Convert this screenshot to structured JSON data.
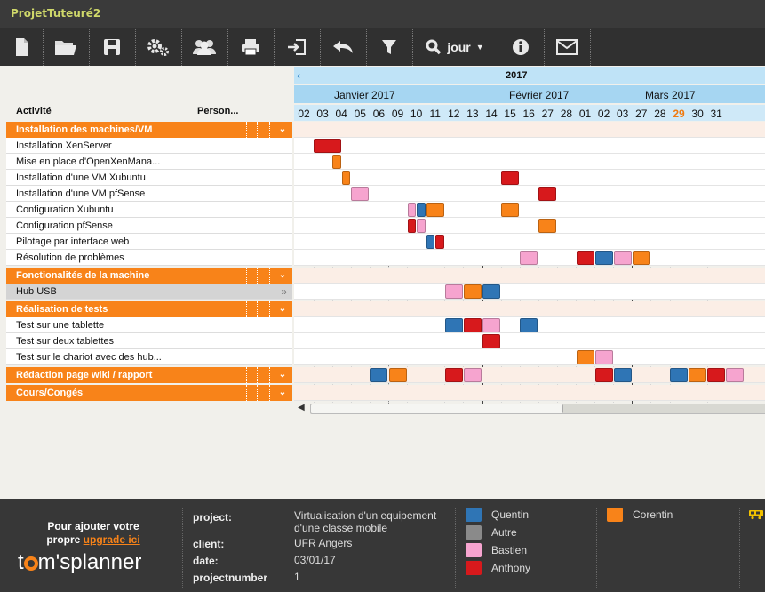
{
  "app": {
    "title": "ProjetTuteuré2"
  },
  "toolbar": {
    "view_label": "jour"
  },
  "columns": {
    "activity": "Activité",
    "person": "Person..."
  },
  "timeline": {
    "year": "2017",
    "months": [
      "Janvier 2017",
      "Février 2017",
      "Mars 2017"
    ],
    "days": [
      "02",
      "03",
      "04",
      "05",
      "06",
      "09",
      "10",
      "11",
      "12",
      "13",
      "14",
      "15",
      "16",
      "27",
      "28",
      "01",
      "02",
      "03",
      "27",
      "28",
      "29",
      "30",
      "31"
    ],
    "today_index": 20
  },
  "colors": {
    "Quentin": "#2f75b5",
    "Autre": "#8a8a8a",
    "Bastien": "#f6a4cf",
    "Anthony": "#d7191c",
    "Corentin": "#f88319"
  },
  "rows": [
    {
      "type": "group",
      "label": "Installation des machines/VM",
      "bars": []
    },
    {
      "type": "task",
      "label": "Installation XenServer",
      "bars": [
        {
          "d": 1,
          "n": 1.5,
          "who": "Anthony"
        }
      ]
    },
    {
      "type": "task",
      "label": "Mise en place d'OpenXenMana...",
      "bars": [
        {
          "d": 2,
          "n": 0.5,
          "who": "Corentin"
        }
      ]
    },
    {
      "type": "task",
      "label": "Installation d'une VM Xubuntu",
      "bars": [
        {
          "d": 2.5,
          "n": 0.5,
          "who": "Corentin"
        },
        {
          "d": 11,
          "n": 1,
          "who": "Anthony"
        }
      ]
    },
    {
      "type": "task",
      "label": "Installation d'une VM pfSense",
      "bars": [
        {
          "d": 3,
          "n": 1,
          "who": "Bastien"
        },
        {
          "d": 13,
          "n": 1,
          "who": "Anthony"
        }
      ]
    },
    {
      "type": "task",
      "label": "Configuration Xubuntu",
      "bars": [
        {
          "d": 6,
          "n": 0.5,
          "who": "Bastien"
        },
        {
          "d": 6.5,
          "n": 0.5,
          "who": "Quentin"
        },
        {
          "d": 7,
          "n": 1,
          "who": "Corentin"
        },
        {
          "d": 11,
          "n": 1,
          "who": "Corentin"
        }
      ]
    },
    {
      "type": "task",
      "label": "Configuration pfSense",
      "bars": [
        {
          "d": 6,
          "n": 0.5,
          "who": "Anthony"
        },
        {
          "d": 6.5,
          "n": 0.5,
          "who": "Bastien"
        },
        {
          "d": 13,
          "n": 1,
          "who": "Corentin"
        }
      ]
    },
    {
      "type": "task",
      "label": "Pilotage par interface web",
      "bars": [
        {
          "d": 7,
          "n": 0.5,
          "who": "Quentin"
        },
        {
          "d": 7.5,
          "n": 0.5,
          "who": "Anthony"
        }
      ]
    },
    {
      "type": "task",
      "label": "Résolution de problèmes",
      "bars": [
        {
          "d": 12,
          "n": 1,
          "who": "Bastien"
        },
        {
          "d": 15,
          "n": 1,
          "who": "Anthony"
        },
        {
          "d": 16,
          "n": 1,
          "who": "Quentin"
        },
        {
          "d": 17,
          "n": 1,
          "who": "Bastien"
        },
        {
          "d": 18,
          "n": 1,
          "who": "Corentin"
        }
      ]
    },
    {
      "type": "group",
      "label": "Fonctionalités de la machine",
      "bars": []
    },
    {
      "type": "task",
      "label": "Hub USB",
      "selected": true,
      "bars": [
        {
          "d": 8,
          "n": 1,
          "who": "Bastien"
        },
        {
          "d": 9,
          "n": 1,
          "who": "Corentin"
        },
        {
          "d": 10,
          "n": 1,
          "who": "Quentin"
        }
      ]
    },
    {
      "type": "group",
      "label": "Réalisation de tests",
      "bars": []
    },
    {
      "type": "task",
      "label": "Test sur une tablette",
      "bars": [
        {
          "d": 8,
          "n": 1,
          "who": "Quentin"
        },
        {
          "d": 9,
          "n": 1,
          "who": "Anthony"
        },
        {
          "d": 10,
          "n": 1,
          "who": "Bastien"
        },
        {
          "d": 12,
          "n": 1,
          "who": "Quentin"
        }
      ]
    },
    {
      "type": "task",
      "label": "Test sur deux tablettes",
      "bars": [
        {
          "d": 10,
          "n": 1,
          "who": "Anthony"
        }
      ]
    },
    {
      "type": "task",
      "label": "Test sur le chariot avec des hub...",
      "bars": [
        {
          "d": 15,
          "n": 1,
          "who": "Corentin"
        },
        {
          "d": 16,
          "n": 1,
          "who": "Bastien"
        }
      ]
    },
    {
      "type": "group",
      "label": "Rédaction page wiki / rapport",
      "bars": [
        {
          "d": 4,
          "n": 1,
          "who": "Quentin"
        },
        {
          "d": 5,
          "n": 1,
          "who": "Corentin"
        },
        {
          "d": 8,
          "n": 1,
          "who": "Anthony"
        },
        {
          "d": 9,
          "n": 1,
          "who": "Bastien"
        },
        {
          "d": 16,
          "n": 1,
          "who": "Anthony"
        },
        {
          "d": 17,
          "n": 1,
          "who": "Quentin"
        },
        {
          "d": 20,
          "n": 1,
          "who": "Quentin"
        },
        {
          "d": 21,
          "n": 1,
          "who": "Corentin"
        },
        {
          "d": 22,
          "n": 1,
          "who": "Anthony"
        },
        {
          "d": 23,
          "n": 1,
          "who": "Bastien"
        }
      ]
    },
    {
      "type": "group",
      "label": "Cours/Congés",
      "bars": []
    }
  ],
  "footer": {
    "promo_line1": "Pour ajouter votre",
    "promo_line2_prefix": "propre ",
    "promo_link": "upgrade ici",
    "logo_t": "t",
    "logo_rest": "m'splanner",
    "labels": {
      "project": "project:",
      "client": "client:",
      "date": "date:",
      "projectnumber": "projectnumber"
    },
    "values": {
      "project": "Virtualisation d'un equipement d'une classe mobile",
      "client": "UFR Angers",
      "date": "03/01/17",
      "projectnumber": "1"
    },
    "legend": [
      {
        "name": "Quentin",
        "color": "#2f75b5"
      },
      {
        "name": "Autre",
        "color": "#8a8a8a"
      },
      {
        "name": "Bastien",
        "color": "#f6a4cf"
      },
      {
        "name": "Anthony",
        "color": "#d7191c"
      },
      {
        "name": "Corentin",
        "color": "#f88319"
      }
    ]
  }
}
